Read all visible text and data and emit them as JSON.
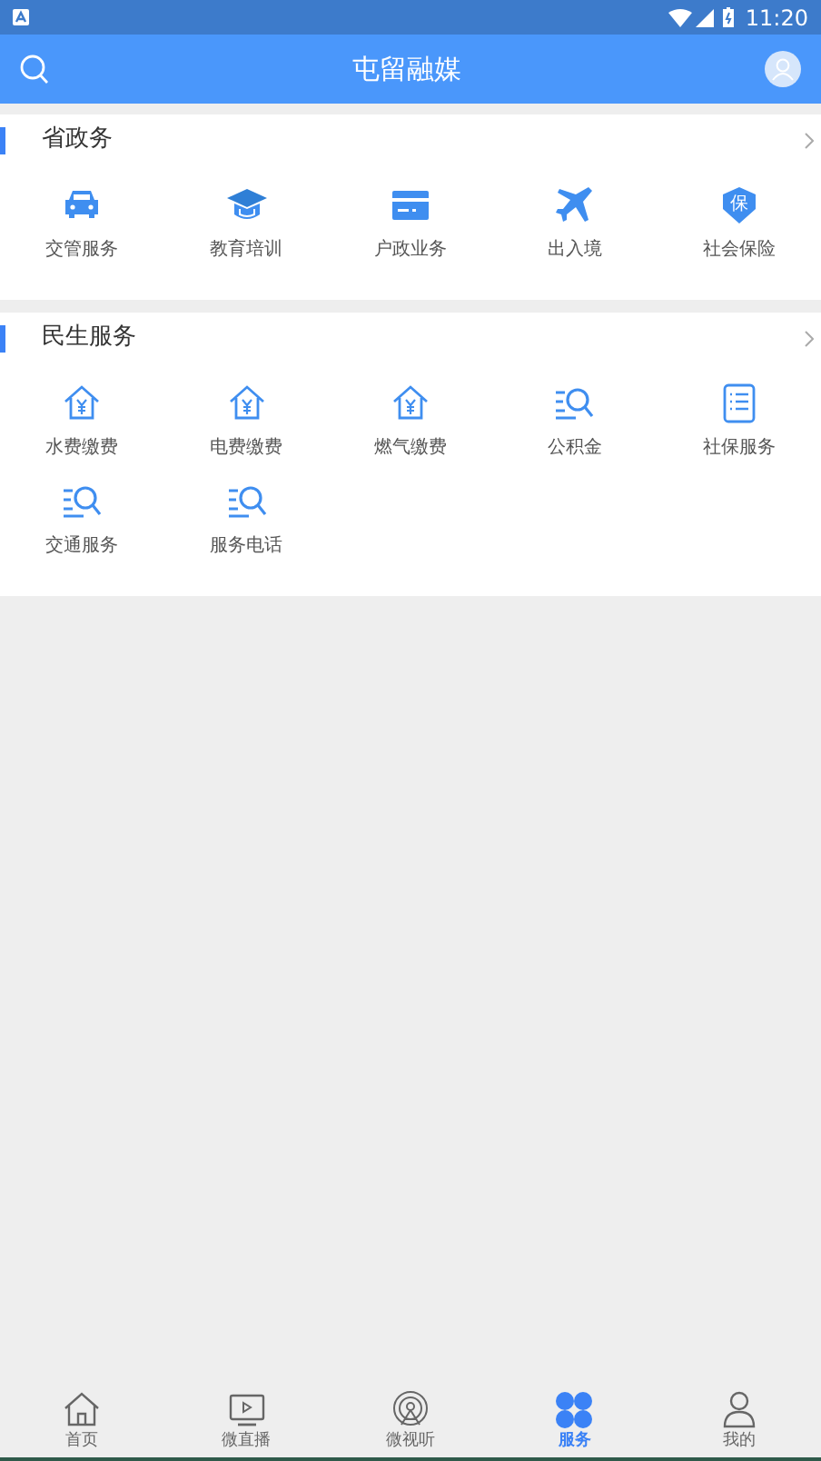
{
  "status_bar": {
    "time": "11:20"
  },
  "header": {
    "title": "屯留融媒"
  },
  "sections": [
    {
      "title": "省政务",
      "items": [
        {
          "label": "交管服务",
          "kind": "car"
        },
        {
          "label": "教育培训",
          "kind": "cap"
        },
        {
          "label": "户政业务",
          "kind": "card"
        },
        {
          "label": "出入境",
          "kind": "plane"
        },
        {
          "label": "社会保险",
          "kind": "shield",
          "glyph": "保"
        }
      ]
    },
    {
      "title": "民生服务",
      "items": [
        {
          "label": "水费缴费",
          "kind": "house"
        },
        {
          "label": "电费缴费",
          "kind": "house"
        },
        {
          "label": "燃气缴费",
          "kind": "house"
        },
        {
          "label": "公积金",
          "kind": "search"
        },
        {
          "label": "社保服务",
          "kind": "doc"
        },
        {
          "label": "交通服务",
          "kind": "search"
        },
        {
          "label": "服务电话",
          "kind": "search"
        }
      ]
    }
  ],
  "tabs": [
    {
      "label": "首页",
      "kind": "home",
      "selected": false
    },
    {
      "label": "微直播",
      "kind": "tv",
      "selected": false
    },
    {
      "label": "微视听",
      "kind": "radio",
      "selected": false
    },
    {
      "label": "服务",
      "kind": "clover",
      "selected": true
    },
    {
      "label": "我的",
      "kind": "person",
      "selected": false
    }
  ]
}
